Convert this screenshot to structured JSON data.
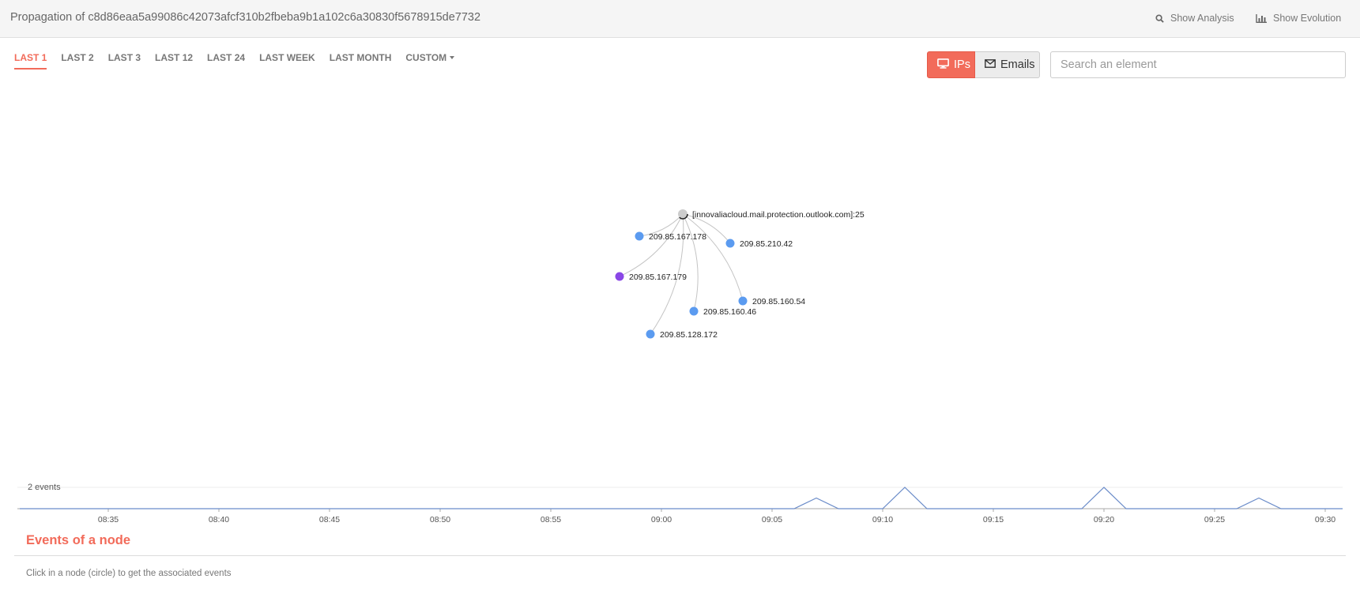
{
  "header": {
    "title": "Propagation of c8d86eaa5a99086c42073afcf310b2fbeba9b1a102c6a30830f5678915de7732",
    "show_analysis_label": "Show Analysis",
    "show_evolution_label": "Show Evolution",
    "show_analysis_icon": "search-icon",
    "show_evolution_icon": "bar-chart-icon"
  },
  "tabs": [
    {
      "label": "LAST 1",
      "active": true
    },
    {
      "label": "LAST 2",
      "active": false
    },
    {
      "label": "LAST 3",
      "active": false
    },
    {
      "label": "LAST 12",
      "active": false
    },
    {
      "label": "LAST 24",
      "active": false
    },
    {
      "label": "LAST WEEK",
      "active": false
    },
    {
      "label": "LAST MONTH",
      "active": false
    },
    {
      "label": "CUSTOM",
      "active": false,
      "dropdown": true
    }
  ],
  "view_toggle": {
    "ips_label": "IPs",
    "emails_label": "Emails",
    "ips_icon": "monitor-icon",
    "emails_icon": "envelope-icon",
    "selected": "IPs"
  },
  "search": {
    "placeholder": "Search an element",
    "value": ""
  },
  "graph": {
    "root": {
      "label": "[innovaliacloud.mail.protection.outlook.com]:25",
      "color": "#cccccc"
    },
    "nodes": [
      {
        "label": "209.85.167.178",
        "color": "#5b9bf0"
      },
      {
        "label": "209.85.210.42",
        "color": "#5b9bf0"
      },
      {
        "label": "209.85.167.179",
        "color": "#8a47e6"
      },
      {
        "label": "209.85.160.54",
        "color": "#5b9bf0"
      },
      {
        "label": "209.85.160.46",
        "color": "#5b9bf0"
      },
      {
        "label": "209.85.128.172",
        "color": "#5b9bf0"
      }
    ]
  },
  "timeline": {
    "y_label": "2 events",
    "x_ticks": [
      "08:35",
      "08:40",
      "08:45",
      "08:50",
      "08:55",
      "09:00",
      "09:05",
      "09:10",
      "09:15",
      "09:20",
      "09:25",
      "09:30"
    ],
    "line_color": "#6b8cc9"
  },
  "chart_data": {
    "type": "line",
    "title": "",
    "xlabel": "",
    "ylabel": "2 events",
    "x": [
      "08:31",
      "09:06",
      "09:07",
      "09:08",
      "09:10",
      "09:11",
      "09:12",
      "09:19",
      "09:20",
      "09:21",
      "09:26",
      "09:27",
      "09:28",
      "09:31"
    ],
    "series": [
      {
        "values": [
          0,
          0,
          1,
          0,
          0,
          2,
          0,
          0,
          2,
          0,
          0,
          1,
          0,
          0
        ]
      }
    ],
    "ylim": [
      0,
      2
    ],
    "grid": false
  },
  "events": {
    "title": "Events of a node",
    "hint": "Click in a node (circle) to get the associated events"
  },
  "colors": {
    "accent": "#f26b5a",
    "node_blue": "#5b9bf0",
    "node_purple": "#8a47e6"
  }
}
